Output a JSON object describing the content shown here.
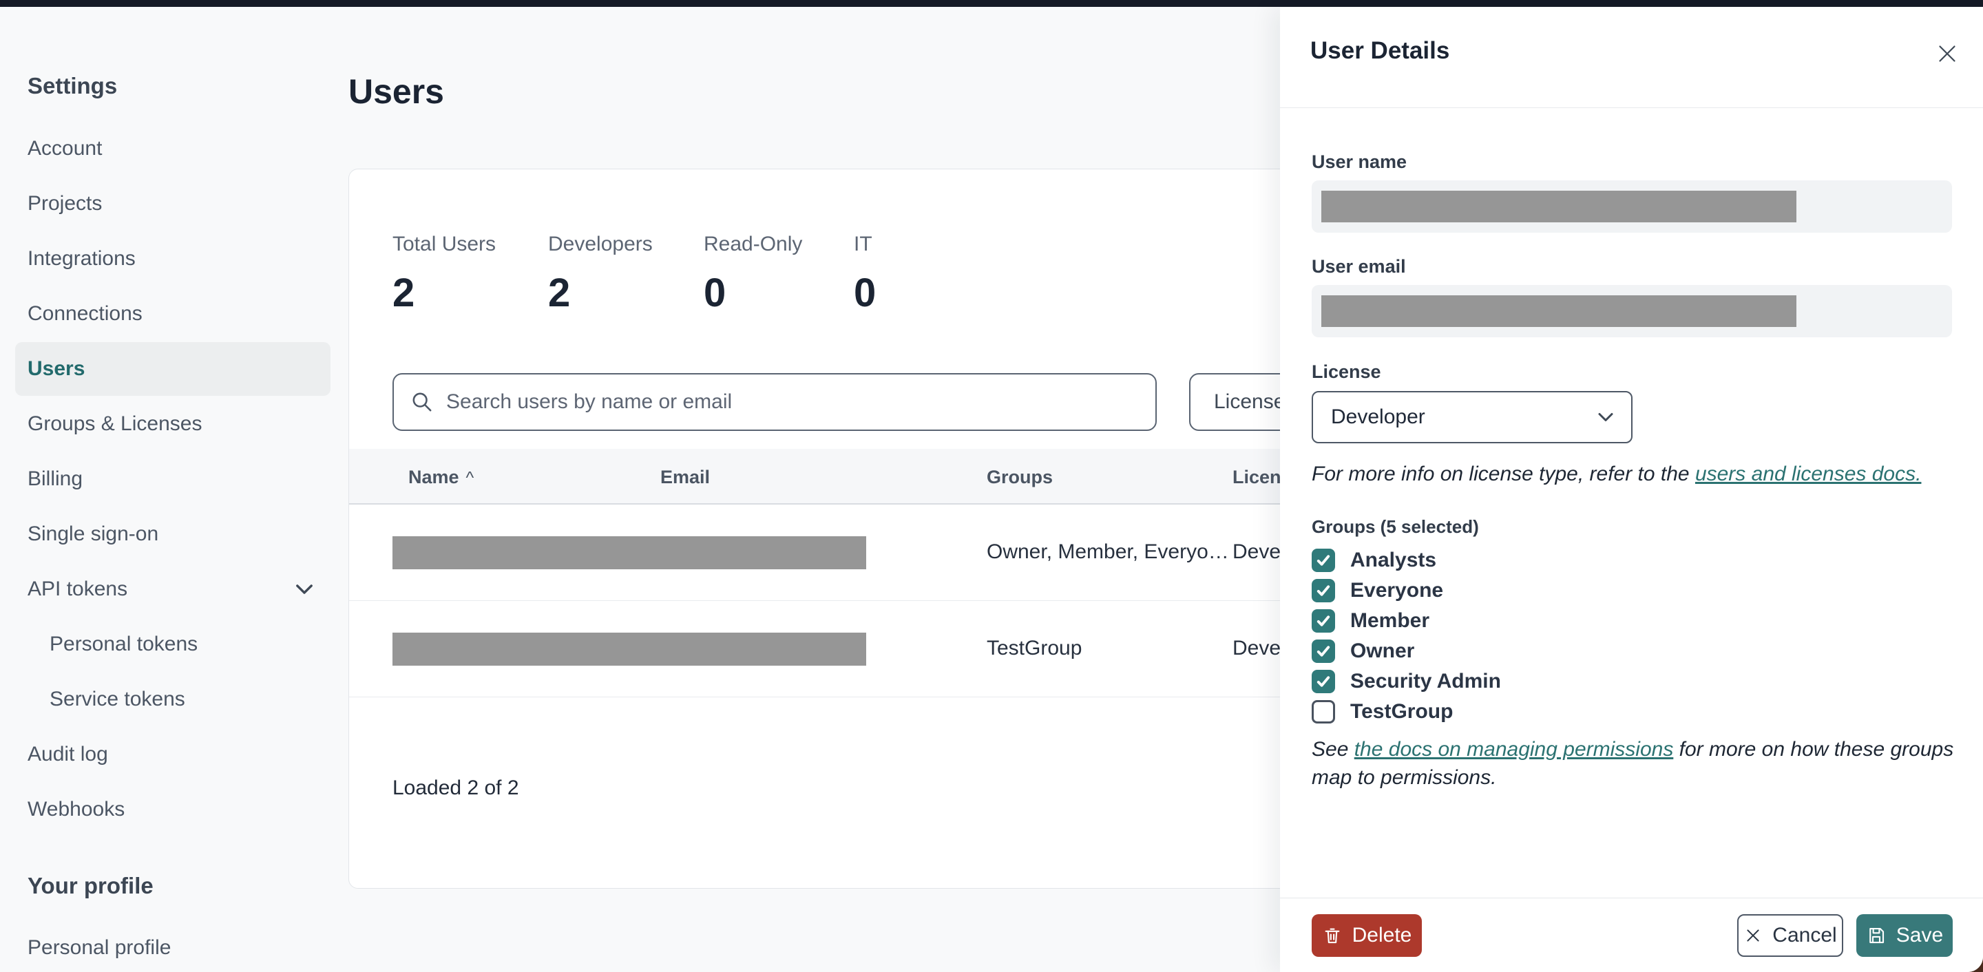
{
  "colors": {
    "accent_teal": "#2F7A7A",
    "link_teal": "#2B7271",
    "delete_red": "#AD392C",
    "topbar": "#151A26",
    "page_bg": "#F8F9FA",
    "redaction_gray": "#969696"
  },
  "sidebar": {
    "settings_header": "Settings",
    "items": [
      {
        "label": "Account"
      },
      {
        "label": "Projects"
      },
      {
        "label": "Integrations"
      },
      {
        "label": "Connections"
      },
      {
        "label": "Users",
        "active": true
      },
      {
        "label": "Groups & Licenses"
      },
      {
        "label": "Billing"
      },
      {
        "label": "Single sign-on"
      },
      {
        "label": "API tokens",
        "has_chevron": true
      },
      {
        "label": "Personal tokens",
        "indent": true
      },
      {
        "label": "Service tokens",
        "indent": true
      },
      {
        "label": "Audit log"
      },
      {
        "label": "Webhooks"
      }
    ],
    "profile_header": "Your profile",
    "profile_item": "Personal profile"
  },
  "main": {
    "title": "Users",
    "stats": [
      {
        "label": "Total Users",
        "value": "2"
      },
      {
        "label": "Developers",
        "value": "2"
      },
      {
        "label": "Read-Only",
        "value": "0"
      },
      {
        "label": "IT",
        "value": "0"
      }
    ],
    "search_placeholder": "Search users by name or email",
    "license_filter_label": "License",
    "table": {
      "columns": [
        "Name",
        "Email",
        "Groups",
        "License"
      ],
      "sort_icon": "^",
      "rows": [
        {
          "name_redacted": true,
          "groups": "Owner, Member, Everyo…",
          "license": "Developer"
        },
        {
          "name_redacted": true,
          "groups": "TestGroup",
          "license": "Developer"
        }
      ]
    },
    "loaded_status": "Loaded 2 of 2"
  },
  "panel": {
    "title": "User Details",
    "user_name_label": "User name",
    "user_email_label": "User email",
    "license_label": "License",
    "license_value": "Developer",
    "license_note_prefix": "For more info on license type, refer to the ",
    "license_note_link": "users and licenses docs.",
    "groups_label": "Groups (5 selected)",
    "groups": [
      {
        "label": "Analysts",
        "checked": true
      },
      {
        "label": "Everyone",
        "checked": true
      },
      {
        "label": "Member",
        "checked": true
      },
      {
        "label": "Owner",
        "checked": true
      },
      {
        "label": "Security Admin",
        "checked": true
      },
      {
        "label": "TestGroup",
        "checked": false
      }
    ],
    "permissions_note_prefix": "See ",
    "permissions_note_link": "the docs on managing permissions",
    "permissions_note_suffix": " for more on how these groups map to permissions.",
    "delete_label": "Delete",
    "cancel_label": "Cancel",
    "save_label": "Save"
  }
}
